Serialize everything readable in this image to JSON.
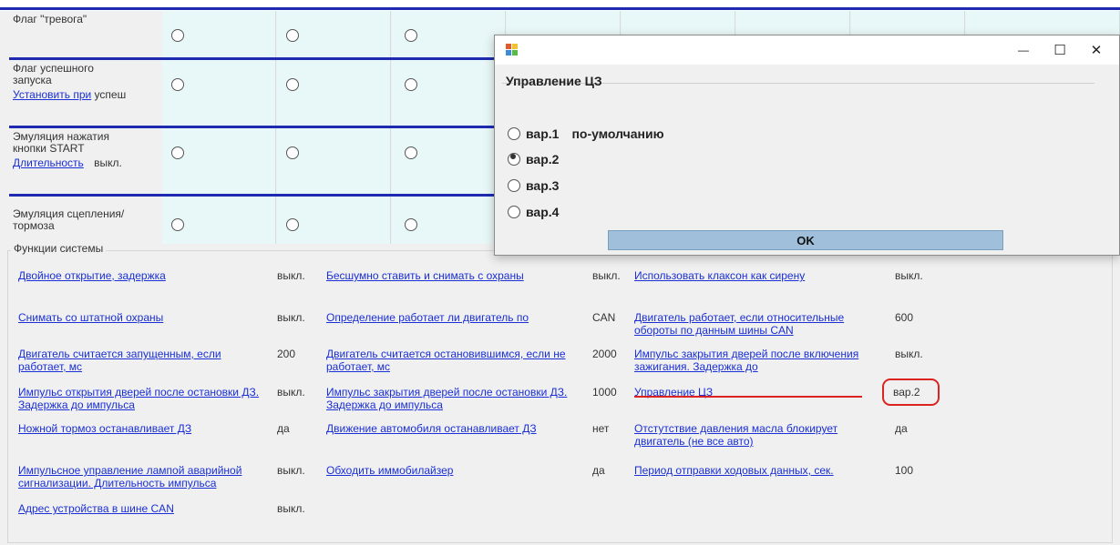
{
  "grid": {
    "rows": [
      {
        "label": "Флаг \"тревога\"",
        "link": "",
        "suffix": ""
      },
      {
        "label": "Флаг успешного запуска",
        "link": "Установить при",
        "suffix": "успеш"
      },
      {
        "label": "Эмуляция нажатия кнопки START",
        "link": "Длительность",
        "suffix": "выкл."
      },
      {
        "label": "Эмуляция сцепления/тормоза",
        "link": "",
        "suffix": ""
      }
    ]
  },
  "functions": {
    "title": "Функции системы",
    "items": [
      {
        "label": "Двойное открытие, задержка",
        "value": "выкл."
      },
      {
        "label": "Бесшумно ставить и снимать с охраны",
        "value": "выкл."
      },
      {
        "label": "Использовать клаксон как сирену",
        "value": "выкл."
      },
      {
        "label": "Снимать со штатной охраны",
        "value": "выкл."
      },
      {
        "label": "Определение работает ли двигатель по",
        "value": "CAN"
      },
      {
        "label": "Двигатель работает, если относительные обороты по данным шины CAN",
        "value": "600"
      },
      {
        "label": "Двигатель считается запущенным, если работает, мс",
        "value": "200"
      },
      {
        "label": "Двигатель считается остановившимся, если не работает, мс",
        "value": "2000"
      },
      {
        "label": "Импульс закрытия дверей после включения зажигания. Задержка до",
        "value": "выкл."
      },
      {
        "label": "Импульс открытия дверей после остановки ДЗ. Задержка до импульса",
        "value": "выкл."
      },
      {
        "label": "Импульс закрытия дверей после остановки ДЗ. Задержка до импульса",
        "value": "1000"
      },
      {
        "label": "Управление ЦЗ",
        "value": "вар.2"
      },
      {
        "label": "Ножной тормоз останавливает ДЗ",
        "value": "да"
      },
      {
        "label": "Движение автомобиля останавливает ДЗ",
        "value": "нет"
      },
      {
        "label": "Отстутствие давления масла блокирует двигатель (не все авто)",
        "value": "да"
      },
      {
        "label": "Импульсное управление лампой аварийной сигнализации. Длительность импульса",
        "value": "выкл."
      },
      {
        "label": "Обходить иммобилайзер",
        "value": "да"
      },
      {
        "label": "Период отправки ходовых данных, сек.",
        "value": "100"
      },
      {
        "label": "Адрес устройства в шине CAN",
        "value": "выкл."
      }
    ]
  },
  "dialog": {
    "title_controls": {
      "minimize": "—",
      "maximize": "☐",
      "close": "✕"
    },
    "heading": "Управление ЦЗ",
    "options": [
      {
        "label": "вар.1",
        "note": "по-умолчанию",
        "selected": false
      },
      {
        "label": "вар.2",
        "note": "",
        "selected": true
      },
      {
        "label": "вар.3",
        "note": "",
        "selected": false
      },
      {
        "label": "вар.4",
        "note": "",
        "selected": false
      }
    ],
    "ok_label": "OK"
  },
  "colors": {
    "accent_blue": "#1e2bb0",
    "link": "#1a2fd6",
    "highlight_red": "#d22222",
    "ok_button": "#9fbfda",
    "cell_bg": "#e8f7f7"
  }
}
